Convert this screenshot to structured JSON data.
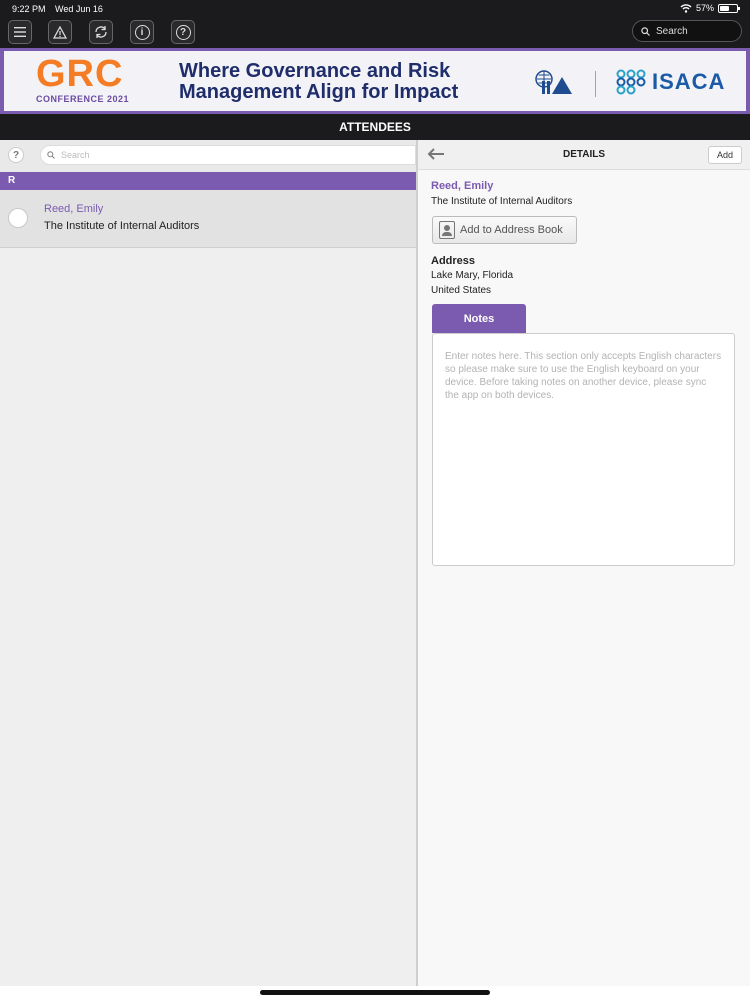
{
  "status": {
    "time": "9:22 PM",
    "date": "Wed Jun 16",
    "battery": "57%"
  },
  "toolbar": {
    "search_label": "Search"
  },
  "banner": {
    "grc": "GRC",
    "conference": "CONFERENCE 2021",
    "tagline_line1": "Where Governance and Risk",
    "tagline_line2": "Management Align for Impact",
    "isaca": "ISACA"
  },
  "page_title": "ATTENDEES",
  "left": {
    "search_placeholder": "Search",
    "section": "R",
    "attendees": [
      {
        "name": "Reed, Emily",
        "org": "The Institute of Internal Auditors"
      }
    ]
  },
  "details": {
    "title": "DETAILS",
    "add_label": "Add",
    "name": "Reed, Emily",
    "org": "The Institute of Internal Auditors",
    "address_book_label": "Add to Address Book",
    "address_label": "Address",
    "address_line1": "Lake Mary, Florida",
    "address_line2": "United States",
    "notes_tab": "Notes",
    "notes_placeholder": "Enter notes here. This section only accepts English characters so please make sure to use the English keyboard on your device. Before taking notes on another device, please sync the app on both devices."
  },
  "colors": {
    "accent": "#7b5bb0",
    "grc_orange": "#f37c25",
    "banner_navy": "#1f2d6b",
    "isaca_blue": "#1a5aa6"
  }
}
